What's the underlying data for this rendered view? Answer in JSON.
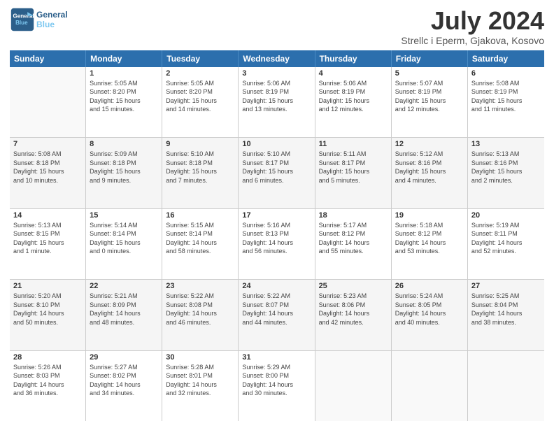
{
  "logo": {
    "line1": "General",
    "line2": "Blue"
  },
  "title": "July 2024",
  "location": "Strellc i Eperm, Gjakova, Kosovo",
  "weekdays": [
    "Sunday",
    "Monday",
    "Tuesday",
    "Wednesday",
    "Thursday",
    "Friday",
    "Saturday"
  ],
  "weeks": [
    [
      {
        "day": "",
        "info": ""
      },
      {
        "day": "1",
        "info": "Sunrise: 5:05 AM\nSunset: 8:20 PM\nDaylight: 15 hours\nand 15 minutes."
      },
      {
        "day": "2",
        "info": "Sunrise: 5:05 AM\nSunset: 8:20 PM\nDaylight: 15 hours\nand 14 minutes."
      },
      {
        "day": "3",
        "info": "Sunrise: 5:06 AM\nSunset: 8:19 PM\nDaylight: 15 hours\nand 13 minutes."
      },
      {
        "day": "4",
        "info": "Sunrise: 5:06 AM\nSunset: 8:19 PM\nDaylight: 15 hours\nand 12 minutes."
      },
      {
        "day": "5",
        "info": "Sunrise: 5:07 AM\nSunset: 8:19 PM\nDaylight: 15 hours\nand 12 minutes."
      },
      {
        "day": "6",
        "info": "Sunrise: 5:08 AM\nSunset: 8:19 PM\nDaylight: 15 hours\nand 11 minutes."
      }
    ],
    [
      {
        "day": "7",
        "info": "Sunrise: 5:08 AM\nSunset: 8:18 PM\nDaylight: 15 hours\nand 10 minutes."
      },
      {
        "day": "8",
        "info": "Sunrise: 5:09 AM\nSunset: 8:18 PM\nDaylight: 15 hours\nand 9 minutes."
      },
      {
        "day": "9",
        "info": "Sunrise: 5:10 AM\nSunset: 8:18 PM\nDaylight: 15 hours\nand 7 minutes."
      },
      {
        "day": "10",
        "info": "Sunrise: 5:10 AM\nSunset: 8:17 PM\nDaylight: 15 hours\nand 6 minutes."
      },
      {
        "day": "11",
        "info": "Sunrise: 5:11 AM\nSunset: 8:17 PM\nDaylight: 15 hours\nand 5 minutes."
      },
      {
        "day": "12",
        "info": "Sunrise: 5:12 AM\nSunset: 8:16 PM\nDaylight: 15 hours\nand 4 minutes."
      },
      {
        "day": "13",
        "info": "Sunrise: 5:13 AM\nSunset: 8:16 PM\nDaylight: 15 hours\nand 2 minutes."
      }
    ],
    [
      {
        "day": "14",
        "info": "Sunrise: 5:13 AM\nSunset: 8:15 PM\nDaylight: 15 hours\nand 1 minute."
      },
      {
        "day": "15",
        "info": "Sunrise: 5:14 AM\nSunset: 8:14 PM\nDaylight: 15 hours\nand 0 minutes."
      },
      {
        "day": "16",
        "info": "Sunrise: 5:15 AM\nSunset: 8:14 PM\nDaylight: 14 hours\nand 58 minutes."
      },
      {
        "day": "17",
        "info": "Sunrise: 5:16 AM\nSunset: 8:13 PM\nDaylight: 14 hours\nand 56 minutes."
      },
      {
        "day": "18",
        "info": "Sunrise: 5:17 AM\nSunset: 8:12 PM\nDaylight: 14 hours\nand 55 minutes."
      },
      {
        "day": "19",
        "info": "Sunrise: 5:18 AM\nSunset: 8:12 PM\nDaylight: 14 hours\nand 53 minutes."
      },
      {
        "day": "20",
        "info": "Sunrise: 5:19 AM\nSunset: 8:11 PM\nDaylight: 14 hours\nand 52 minutes."
      }
    ],
    [
      {
        "day": "21",
        "info": "Sunrise: 5:20 AM\nSunset: 8:10 PM\nDaylight: 14 hours\nand 50 minutes."
      },
      {
        "day": "22",
        "info": "Sunrise: 5:21 AM\nSunset: 8:09 PM\nDaylight: 14 hours\nand 48 minutes."
      },
      {
        "day": "23",
        "info": "Sunrise: 5:22 AM\nSunset: 8:08 PM\nDaylight: 14 hours\nand 46 minutes."
      },
      {
        "day": "24",
        "info": "Sunrise: 5:22 AM\nSunset: 8:07 PM\nDaylight: 14 hours\nand 44 minutes."
      },
      {
        "day": "25",
        "info": "Sunrise: 5:23 AM\nSunset: 8:06 PM\nDaylight: 14 hours\nand 42 minutes."
      },
      {
        "day": "26",
        "info": "Sunrise: 5:24 AM\nSunset: 8:05 PM\nDaylight: 14 hours\nand 40 minutes."
      },
      {
        "day": "27",
        "info": "Sunrise: 5:25 AM\nSunset: 8:04 PM\nDaylight: 14 hours\nand 38 minutes."
      }
    ],
    [
      {
        "day": "28",
        "info": "Sunrise: 5:26 AM\nSunset: 8:03 PM\nDaylight: 14 hours\nand 36 minutes."
      },
      {
        "day": "29",
        "info": "Sunrise: 5:27 AM\nSunset: 8:02 PM\nDaylight: 14 hours\nand 34 minutes."
      },
      {
        "day": "30",
        "info": "Sunrise: 5:28 AM\nSunset: 8:01 PM\nDaylight: 14 hours\nand 32 minutes."
      },
      {
        "day": "31",
        "info": "Sunrise: 5:29 AM\nSunset: 8:00 PM\nDaylight: 14 hours\nand 30 minutes."
      },
      {
        "day": "",
        "info": ""
      },
      {
        "day": "",
        "info": ""
      },
      {
        "day": "",
        "info": ""
      }
    ]
  ]
}
